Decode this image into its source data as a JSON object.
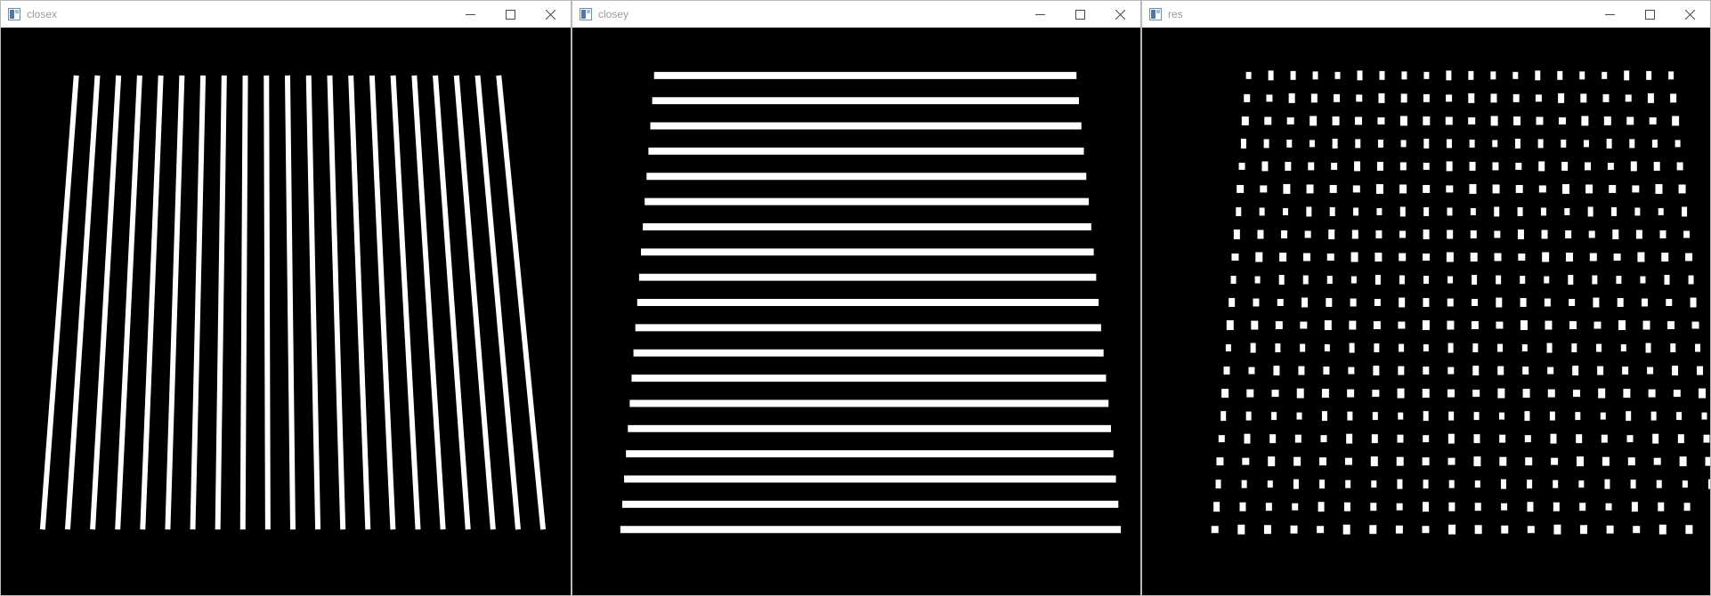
{
  "windows": [
    {
      "id": "closex",
      "title": "closex",
      "image_content": "vertical white lines on black"
    },
    {
      "id": "closey",
      "title": "closey",
      "image_content": "horizontal white lines on black"
    },
    {
      "id": "res",
      "title": "res",
      "image_content": "grid of white points on black"
    }
  ],
  "grid": {
    "vertical_line_count": 21,
    "horizontal_line_count": 19,
    "point_rows": 21,
    "point_cols": 20
  },
  "colors": {
    "background": "#000000",
    "foreground": "#ffffff",
    "title_text": "#9a9a9a",
    "caption_icon": "#4a4a4a"
  },
  "icons": [
    "app-icon",
    "minimize-icon",
    "maximize-icon",
    "close-icon"
  ]
}
